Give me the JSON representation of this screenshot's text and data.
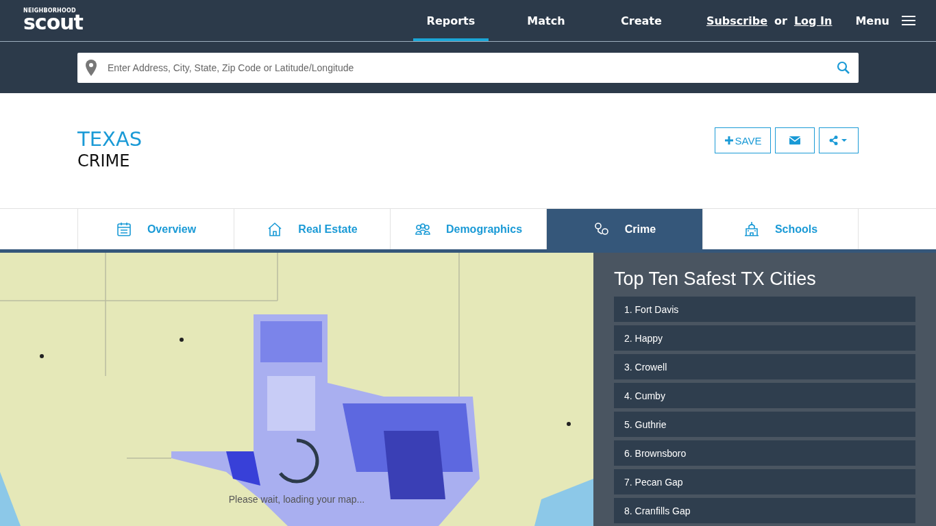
{
  "logo": {
    "top": "NEIGHBORHOOD",
    "bottom": "scout"
  },
  "nav": [
    {
      "label": "Reports",
      "selected": true
    },
    {
      "label": "Match",
      "selected": false
    },
    {
      "label": "Create",
      "selected": false
    }
  ],
  "account": {
    "subscribe": "Subscribe",
    "or": "or",
    "login": "Log In"
  },
  "menu": {
    "label": "Menu"
  },
  "search": {
    "placeholder": "Enter Address, City, State, Zip Code or Latitude/Longitude"
  },
  "page": {
    "title": "TEXAS",
    "subtitle": "CRIME"
  },
  "actions": {
    "save": "SAVE"
  },
  "tabs": [
    {
      "label": "Overview",
      "kind": "calendar",
      "selected": false
    },
    {
      "label": "Real Estate",
      "kind": "house",
      "selected": false
    },
    {
      "label": "Demographics",
      "kind": "people",
      "selected": false
    },
    {
      "label": "Crime",
      "kind": "handcuffs",
      "selected": true
    },
    {
      "label": "Schools",
      "kind": "school",
      "selected": false
    }
  ],
  "map": {
    "kind": "picture",
    "loading": "Please wait, loading your map..."
  },
  "safest": {
    "title": "Top Ten Safest TX Cities",
    "items": [
      "1. Fort Davis",
      "2. Happy",
      "3. Crowell",
      "4. Cumby",
      "5. Guthrie",
      "6. Brownsboro",
      "7. Pecan Gap",
      "8. Cranfills Gap"
    ]
  }
}
